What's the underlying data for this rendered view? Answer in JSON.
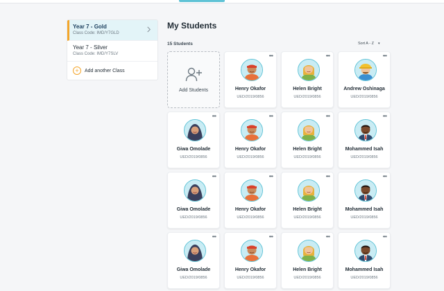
{
  "classes": [
    {
      "name": "Year 7 - Gold",
      "code": "Class Code: IMD/Y7GLD",
      "active": true
    },
    {
      "name": "Year 7 - Silver",
      "code": "Class Code: IMD/Y7SLV",
      "active": false
    }
  ],
  "add_class_label": "Add another Class",
  "main": {
    "title": "My Students",
    "count": "15 Students",
    "sort_label": "Sort A - Z",
    "add_students_label": "Add Students"
  },
  "students": [
    {
      "name": "Henry Okafor",
      "id": "UED/2019/0856",
      "avatar": "boy-cap-avatar"
    },
    {
      "name": "Helen Bright",
      "id": "UED/2019/0856",
      "avatar": "girl-blonde-avatar"
    },
    {
      "name": "Andrew Oshinaga",
      "id": "UED/2019/0856",
      "avatar": "boy-hardhat-avatar"
    },
    {
      "name": "Giwa Omolade",
      "id": "UED/2019/0856",
      "avatar": "girl-hijab-avatar"
    },
    {
      "name": "Henry Okafor",
      "id": "UED/2019/0856",
      "avatar": "boy-cap-avatar"
    },
    {
      "name": "Helen Bright",
      "id": "UED/2019/0856",
      "avatar": "girl-blonde-avatar"
    },
    {
      "name": "Mohammed Isah",
      "id": "UED/2019/0856",
      "avatar": "man-tie-avatar"
    },
    {
      "name": "Giwa Omolade",
      "id": "UED/2019/0856",
      "avatar": "girl-hijab-avatar"
    },
    {
      "name": "Henry Okafor",
      "id": "UED/2019/0856",
      "avatar": "boy-cap-avatar"
    },
    {
      "name": "Helen Bright",
      "id": "UED/2019/0856",
      "avatar": "girl-blonde-avatar"
    },
    {
      "name": "Mohammed Isah",
      "id": "UED/2019/0856",
      "avatar": "man-tie-avatar"
    },
    {
      "name": "Giwa Omolade",
      "id": "UED/2019/0856",
      "avatar": "girl-hijab-avatar"
    },
    {
      "name": "Henry Okafor",
      "id": "UED/2019/0856",
      "avatar": "boy-cap-avatar"
    },
    {
      "name": "Helen Bright",
      "id": "UED/2019/0856",
      "avatar": "girl-blonde-avatar"
    },
    {
      "name": "Mohammed Isah",
      "id": "UED/2019/0856",
      "avatar": "man-tie-avatar"
    }
  ],
  "colors": {
    "accent": "#5fc3d6",
    "active_marker": "#f4a52a",
    "active_bg": "#e3f4f8"
  }
}
